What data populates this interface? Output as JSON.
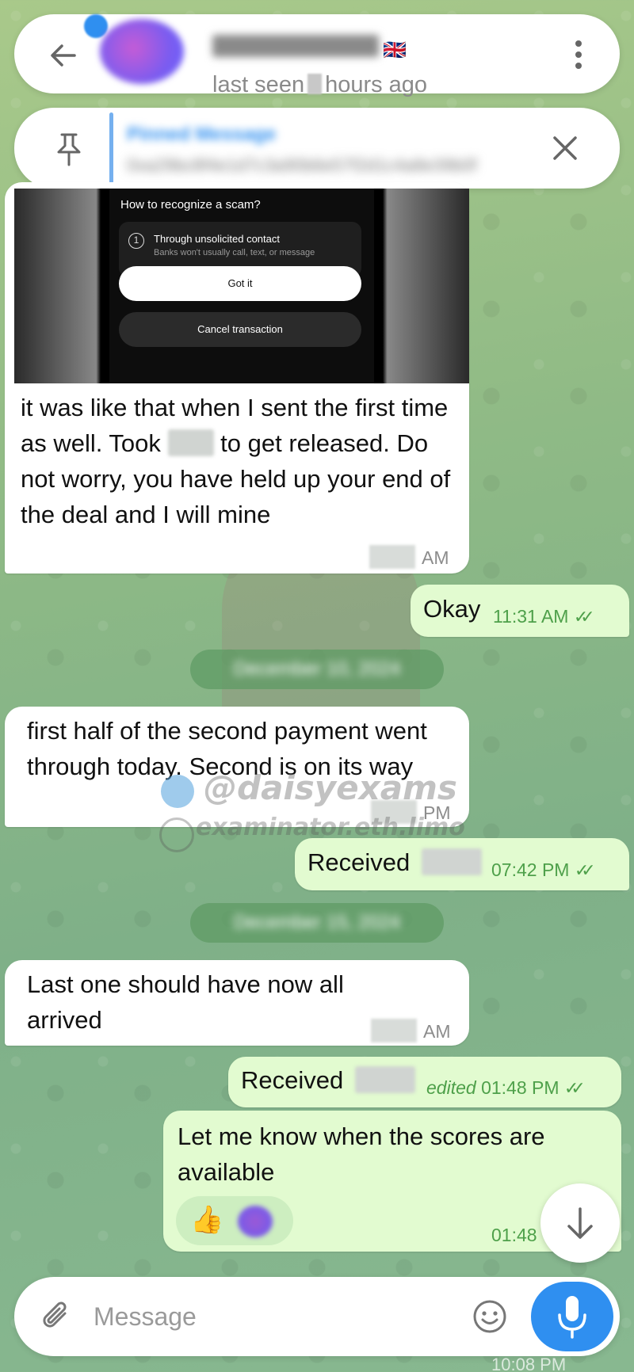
{
  "colors": {
    "accent": "#2f8ff0",
    "outgoing_bubble": "#e2fbd0",
    "incoming_bubble": "#ffffff",
    "time_outgoing": "#4ea04a"
  },
  "header": {
    "last_seen_prefix": "last seen",
    "last_seen_suffix": "hours ago",
    "flag": "🇬🇧",
    "back_icon": "arrow-left-icon",
    "menu_icon": "more-vertical-icon"
  },
  "pinned": {
    "title": "Pinned Message",
    "preview": "0xa29bc8f4e1d7c3a90b6e57f2d1c4a8e39b0f",
    "pin_icon": "pin-icon",
    "close_icon": "close-icon"
  },
  "screenshot": {
    "question": "How to recognize a scam?",
    "item_number": "1",
    "item_title": "Through unsolicited contact",
    "item_subtitle": "Banks won't usually call, text, or message",
    "primary_button": "Got it",
    "secondary_button": "Cancel transaction"
  },
  "messages": [
    {
      "id": "m1",
      "direction": "in",
      "text_part1": "it was like that when I sent the first time as well. Took",
      "text_part2": "to get released. Do not worry, you have held up your end of the deal and I will mine",
      "time_suffix": "AM"
    },
    {
      "id": "m2",
      "direction": "out",
      "text": "Okay",
      "time": "11:31 AM"
    },
    {
      "id": "m3",
      "direction": "in",
      "text": "first half of the second payment went through today. Second is on its way",
      "time_suffix": "PM"
    },
    {
      "id": "m4",
      "direction": "out",
      "text": "Received",
      "time": "07:42 PM"
    },
    {
      "id": "m5",
      "direction": "in",
      "text": "Last one should have now all arrived",
      "time_suffix": "AM"
    },
    {
      "id": "m6",
      "direction": "out",
      "text": "Received",
      "edited_label": "edited",
      "time": "01:48 PM"
    },
    {
      "id": "m7",
      "direction": "out",
      "text": "Let me know when the scores are available",
      "time": "01:48"
    }
  ],
  "date_chips": [
    {
      "label": "December 10, 2024"
    },
    {
      "label": "December 15, 2024"
    }
  ],
  "reactions": [
    {
      "emoji": "👍"
    }
  ],
  "watermark": {
    "handle": "@daisyexams",
    "site": "examinator.eth.limo"
  },
  "composer": {
    "placeholder": "Message",
    "attach_icon": "paperclip-icon",
    "emoji_icon": "smiley-icon",
    "mic_icon": "microphone-icon"
  },
  "fab_icon": "arrow-down-icon",
  "bottom_peek_time": "10:08 PM"
}
